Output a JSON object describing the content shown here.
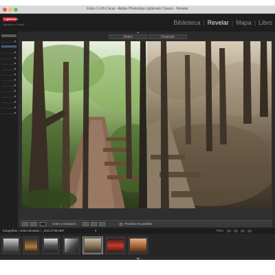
{
  "window": {
    "title": "Fotos 1-Lr8-2.lrcat - Adobe Photoshop Lightroom Classic - Revelar"
  },
  "identity": {
    "logo_text": "Lightroom",
    "subtitle": "Lightroom Classic",
    "modules": [
      {
        "label": "Biblioteca",
        "active": false
      },
      {
        "label": "Revelar",
        "active": true
      },
      {
        "label": "Mapa",
        "active": false
      },
      {
        "label": "Libro",
        "active": false
      }
    ]
  },
  "view": {
    "label_before": "Antes",
    "label_after": "Después"
  },
  "toolbar": {
    "before_after_label": "Antes y Después:",
    "soft_proof_label": "Pruebas en pantalla"
  },
  "filmstrip": {
    "path": "fotografías / selecciónados / _DSC4736.NEF",
    "path_arrow": "▾",
    "filter_label": "Filtro:",
    "thumbnails": [
      {
        "name": "thumb-1",
        "selected": false
      },
      {
        "name": "thumb-2",
        "selected": false
      },
      {
        "name": "thumb-3",
        "selected": false
      },
      {
        "name": "thumb-4",
        "selected": false
      },
      {
        "name": "thumb-5",
        "selected": true
      },
      {
        "name": "thumb-6",
        "selected": false
      },
      {
        "name": "thumb-7",
        "selected": false
      }
    ]
  },
  "colors": {
    "accent_red": "#c8242b",
    "panel_bg": "#2b2b2b",
    "selection": "#5a5a5a"
  }
}
